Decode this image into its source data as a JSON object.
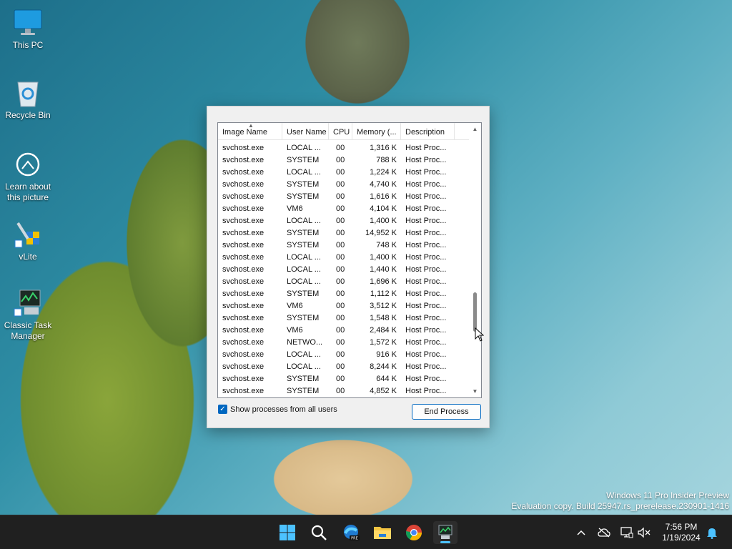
{
  "desktop": {
    "icons": [
      {
        "label": "This PC",
        "icon": "monitor-icon"
      },
      {
        "label": "Recycle Bin",
        "icon": "recycle-bin-icon"
      },
      {
        "label": "Learn about this picture",
        "icon": "camera-icon"
      },
      {
        "label": "vLite",
        "icon": "vlite-icon"
      },
      {
        "label": "Classic Task Manager",
        "icon": "task-manager-icon"
      }
    ]
  },
  "task_manager": {
    "columns": [
      "Image Name",
      "User Name",
      "CPU",
      "Memory (...",
      "Description"
    ],
    "rows": [
      {
        "image": "svchost.exe",
        "user": "LOCAL ...",
        "cpu": "00",
        "mem": "1,316 K",
        "desc": "Host Proc..."
      },
      {
        "image": "svchost.exe",
        "user": "SYSTEM",
        "cpu": "00",
        "mem": "788 K",
        "desc": "Host Proc..."
      },
      {
        "image": "svchost.exe",
        "user": "LOCAL ...",
        "cpu": "00",
        "mem": "1,224 K",
        "desc": "Host Proc..."
      },
      {
        "image": "svchost.exe",
        "user": "SYSTEM",
        "cpu": "00",
        "mem": "4,740 K",
        "desc": "Host Proc..."
      },
      {
        "image": "svchost.exe",
        "user": "SYSTEM",
        "cpu": "00",
        "mem": "1,616 K",
        "desc": "Host Proc..."
      },
      {
        "image": "svchost.exe",
        "user": "VM6",
        "cpu": "00",
        "mem": "4,104 K",
        "desc": "Host Proc..."
      },
      {
        "image": "svchost.exe",
        "user": "LOCAL ...",
        "cpu": "00",
        "mem": "1,400 K",
        "desc": "Host Proc..."
      },
      {
        "image": "svchost.exe",
        "user": "SYSTEM",
        "cpu": "00",
        "mem": "14,952 K",
        "desc": "Host Proc..."
      },
      {
        "image": "svchost.exe",
        "user": "SYSTEM",
        "cpu": "00",
        "mem": "748 K",
        "desc": "Host Proc..."
      },
      {
        "image": "svchost.exe",
        "user": "LOCAL ...",
        "cpu": "00",
        "mem": "1,400 K",
        "desc": "Host Proc..."
      },
      {
        "image": "svchost.exe",
        "user": "LOCAL ...",
        "cpu": "00",
        "mem": "1,440 K",
        "desc": "Host Proc..."
      },
      {
        "image": "svchost.exe",
        "user": "LOCAL ...",
        "cpu": "00",
        "mem": "1,696 K",
        "desc": "Host Proc..."
      },
      {
        "image": "svchost.exe",
        "user": "SYSTEM",
        "cpu": "00",
        "mem": "1,112 K",
        "desc": "Host Proc..."
      },
      {
        "image": "svchost.exe",
        "user": "VM6",
        "cpu": "00",
        "mem": "3,512 K",
        "desc": "Host Proc..."
      },
      {
        "image": "svchost.exe",
        "user": "SYSTEM",
        "cpu": "00",
        "mem": "1,548 K",
        "desc": "Host Proc..."
      },
      {
        "image": "svchost.exe",
        "user": "VM6",
        "cpu": "00",
        "mem": "2,484 K",
        "desc": "Host Proc..."
      },
      {
        "image": "svchost.exe",
        "user": "NETWO...",
        "cpu": "00",
        "mem": "1,572 K",
        "desc": "Host Proc..."
      },
      {
        "image": "svchost.exe",
        "user": "LOCAL ...",
        "cpu": "00",
        "mem": "916 K",
        "desc": "Host Proc..."
      },
      {
        "image": "svchost.exe",
        "user": "LOCAL ...",
        "cpu": "00",
        "mem": "8,244 K",
        "desc": "Host Proc..."
      },
      {
        "image": "svchost.exe",
        "user": "SYSTEM",
        "cpu": "00",
        "mem": "644 K",
        "desc": "Host Proc..."
      },
      {
        "image": "svchost.exe",
        "user": "SYSTEM",
        "cpu": "00",
        "mem": "4,852 K",
        "desc": "Host Proc..."
      }
    ],
    "show_all_label": "Show processes from all users",
    "show_all_checked": true,
    "end_process_label": "End Process"
  },
  "watermark": {
    "line1": "Windows 11 Pro Insider Preview",
    "line2": "Evaluation copy. Build 25947.rs_prerelease.230901-1416"
  },
  "taskbar": {
    "apps": [
      "start-icon",
      "search-icon",
      "edge-dev-icon",
      "file-explorer-icon",
      "chrome-icon",
      "task-manager-icon"
    ],
    "tray": [
      "chevron-up-icon",
      "onedrive-icon",
      "network-icon",
      "volume-muted-icon",
      "notification-bell-icon"
    ],
    "time": "7:56 PM",
    "date": "1/19/2024",
    "accent": "#4cc2ff"
  }
}
